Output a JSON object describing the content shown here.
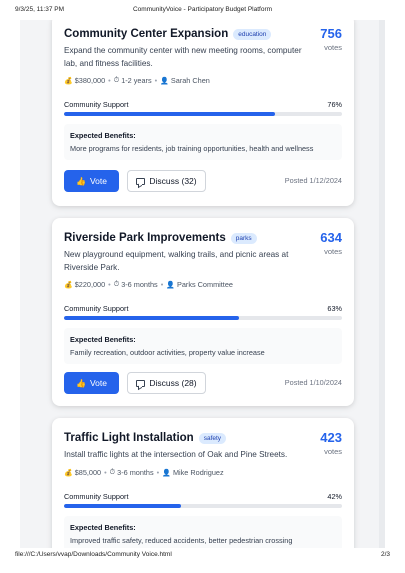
{
  "print_header": {
    "datetime": "9/3/25, 11:37 PM",
    "page_title": "CommunityVoice - Participatory Budget Platform"
  },
  "print_footer": {
    "url": "file:///C:/Users/vvap/Downloads/Community Voice.html",
    "page_number": "2/3"
  },
  "common": {
    "votes_label": "votes",
    "support_label": "Community Support",
    "benefits_title": "Expected Benefits:",
    "vote_button": "Vote",
    "bullet": "•"
  },
  "projects": [
    {
      "title": "Community Center Expansion",
      "category": "education",
      "votes": "756",
      "description": "Expand the community center with new meeting rooms, computer lab, and fitness facilities.",
      "cost": "$380,000",
      "duration": "1-2 years",
      "proposer": "Sarah Chen",
      "support_pct": "76%",
      "support_value": 0.76,
      "benefits": "More programs for residents, job training opportunities, health and wellness",
      "discuss_label": "Discuss (32)",
      "posted": "Posted 1/12/2024"
    },
    {
      "title": "Riverside Park Improvements",
      "category": "parks",
      "votes": "634",
      "description": "New playground equipment, walking trails, and picnic areas at Riverside Park.",
      "cost": "$220,000",
      "duration": "3-6 months",
      "proposer": "Parks Committee",
      "support_pct": "63%",
      "support_value": 0.63,
      "benefits": "Family recreation, outdoor activities, property value increase",
      "discuss_label": "Discuss (28)",
      "posted": "Posted 1/10/2024"
    },
    {
      "title": "Traffic Light Installation",
      "category": "safety",
      "votes": "423",
      "description": "Install traffic lights at the intersection of Oak and Pine Streets.",
      "cost": "$85,000",
      "duration": "3-6 months",
      "proposer": "Mike Rodriguez",
      "support_pct": "42%",
      "support_value": 0.42,
      "benefits": "Improved traffic safety, reduced accidents, better pedestrian crossing"
    }
  ],
  "icons": {
    "cost": "money-bag-icon",
    "duration": "stopwatch-icon",
    "proposer": "person-icon",
    "vote": "thumbs-up-icon",
    "discuss": "speech-bubble-icon"
  }
}
